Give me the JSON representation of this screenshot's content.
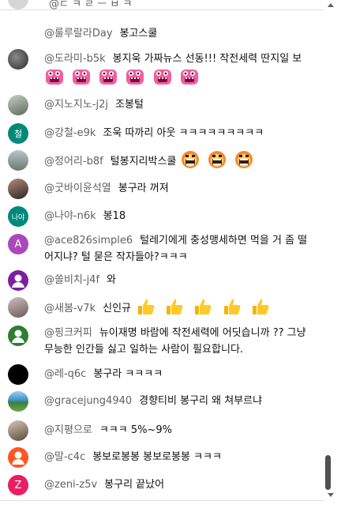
{
  "partial_top": {
    "text": "@ㄷ ㅋ ㄹ ㅡ ㅂ ㅋ"
  },
  "comments": [
    {
      "author": "@룰루랄라Day",
      "text": "봉고스쿨",
      "avatar": {
        "kind": "blank",
        "color": "#ffffff"
      }
    },
    {
      "author": "@도라미-b5k",
      "text": "봉지욱 가짜뉴스 선동!!! 작전세력 딴지일 보",
      "avatar": {
        "kind": "photo",
        "color": "#3a3a3a"
      },
      "emoji": "pink-monster-emoji",
      "emoji_count": 6
    },
    {
      "author": "@지노지노-j2j",
      "text": "조봉털",
      "avatar": {
        "kind": "photo",
        "color": "#7d8a7a"
      }
    },
    {
      "author": "@강철-e9k",
      "text": "조욱 따까리 아웃 ㅋㅋㅋㅋㅋㅋㅋㅋㅋ",
      "avatar": {
        "kind": "letter",
        "letter": "철",
        "color": "#00897b"
      }
    },
    {
      "author": "@정어리-b8f",
      "text": "털봉지리박스쿨",
      "avatar": {
        "kind": "photo",
        "color": "#8f9aa8"
      },
      "emoji": "orange-roaring-face-emoji",
      "emoji_count": 3
    },
    {
      "author": "@굿바이윤석열",
      "text": "봉구라 꺼져",
      "avatar": {
        "kind": "photo",
        "color": "#5a4a4a"
      }
    },
    {
      "author": "@나야-n6k",
      "text": "봉18",
      "avatar": {
        "kind": "letter",
        "letter": "나야",
        "color": "#00897b"
      }
    },
    {
      "author": "@ace826simple6",
      "text": "털레기에게 충성맹세하면 먹을 거 좀 떨어지냐? 털 묻은 작자들아?ㅋㅋㅋ",
      "avatar": {
        "kind": "letter",
        "letter": "A",
        "color": "#ab47bc"
      }
    },
    {
      "author": "@쏠비치-j4f",
      "text": "와",
      "avatar": {
        "kind": "photo",
        "color": "#7b1fa2"
      }
    },
    {
      "author": "@새봄-v7k",
      "text": "신인규",
      "avatar": {
        "kind": "photo",
        "color": "#9a8c8c"
      },
      "emoji": "thumbs-up-emoji",
      "emoji_count": 5
    },
    {
      "author": "@핑크커피",
      "text": "뉴이재명 바람에 작전세력에 어딧습니까 ?? 그냥 무능한 인간들 싫고 일하는 사람이 필요합니다.",
      "avatar": {
        "kind": "photo",
        "color": "#2e7d32"
      }
    },
    {
      "author": "@레-q6c",
      "text": "봉구라 ㅋㅋㅋㅋ",
      "avatar": {
        "kind": "photo",
        "color": "#000000"
      }
    },
    {
      "author": "@gracejung4940",
      "text": "경향티비 봉구리 왜 쳐부르냐",
      "avatar": {
        "kind": "photo",
        "color": "#3d8fc7"
      }
    },
    {
      "author": "@지평으로",
      "text": "ㅋㅋㅋ 5%~9%",
      "avatar": {
        "kind": "photo",
        "color": "#8a7a6a"
      }
    },
    {
      "author": "@말-c4c",
      "text": "봉보로봉봉 봉보로봉봉 ㅋㅋㅋ",
      "avatar": {
        "kind": "photo",
        "color": "#ff5722"
      }
    },
    {
      "author": "@zeni-z5v",
      "text": "봉구리 끝났어",
      "avatar": {
        "kind": "letter",
        "letter": "Z",
        "color": "#e91e63"
      }
    }
  ]
}
